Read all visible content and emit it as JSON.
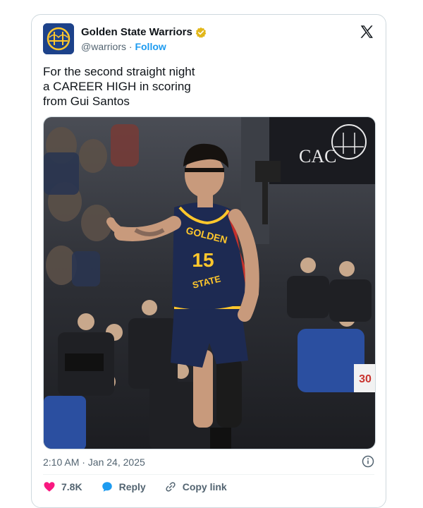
{
  "account": {
    "name": "Golden State Warriors",
    "handle": "@warriors",
    "separator": "·",
    "follow_label": "Follow"
  },
  "tweet": {
    "text": "For the second straight night\na CAREER HIGH in scoring\nfrom Gui Santos"
  },
  "photo": {
    "jersey_wordmark_top": "GOLDEN",
    "jersey_number": "15",
    "jersey_wordmark_bottom": "STATE",
    "arena_sign": "CAC",
    "courtside_number": "30"
  },
  "meta": {
    "timestamp": "2:10 AM · Jan 24, 2025"
  },
  "actions": {
    "likes_count": "7.8K",
    "reply_label": "Reply",
    "copy_link_label": "Copy link"
  },
  "colors": {
    "warriors_blue": "#1d428a",
    "warriors_gold": "#ffc72c",
    "like_pink": "#f91880",
    "link_blue": "#1d9bf0",
    "muted_text": "#536471",
    "verified_gold": "#e2b719"
  },
  "icons": {
    "avatar": "warriors-bridge-logo",
    "verified": "verified-badge-gold",
    "brand": "x-logo",
    "info": "info-icon",
    "like": "heart-icon",
    "reply": "speech-bubble-icon",
    "copy_link": "link-icon"
  }
}
